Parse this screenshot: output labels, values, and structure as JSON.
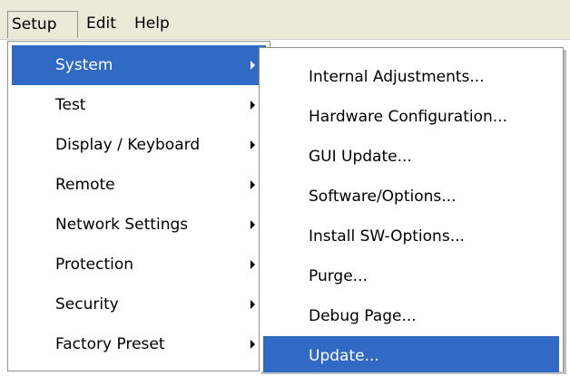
{
  "menubar": {
    "items": [
      {
        "label": "Setup"
      },
      {
        "label": "Edit"
      },
      {
        "label": "Help"
      }
    ]
  },
  "setup_menu": {
    "items": [
      {
        "label": "System",
        "has_submenu": true,
        "highlighted": true
      },
      {
        "label": "Test",
        "has_submenu": true
      },
      {
        "label": "Display / Keyboard",
        "has_submenu": true
      },
      {
        "label": "Remote",
        "has_submenu": true
      },
      {
        "label": "Network Settings",
        "has_submenu": true
      },
      {
        "label": "Protection",
        "has_submenu": true
      },
      {
        "label": "Security",
        "has_submenu": true
      },
      {
        "label": "Factory Preset",
        "has_submenu": true
      }
    ]
  },
  "system_menu": {
    "items": [
      {
        "label": "Internal Adjustments..."
      },
      {
        "label": "Hardware Configuration..."
      },
      {
        "label": "GUI Update..."
      },
      {
        "label": "Software/Options..."
      },
      {
        "label": "Install SW-Options..."
      },
      {
        "label": "Purge..."
      },
      {
        "label": "Debug Page..."
      },
      {
        "label": "Update...",
        "highlighted": true
      }
    ]
  },
  "colors": {
    "highlight": "#316ac5",
    "menubar_bg": "#ece9d8",
    "menu_bg": "#ffffff"
  },
  "icons": {
    "submenu_arrow": "submenu-arrow-icon"
  }
}
